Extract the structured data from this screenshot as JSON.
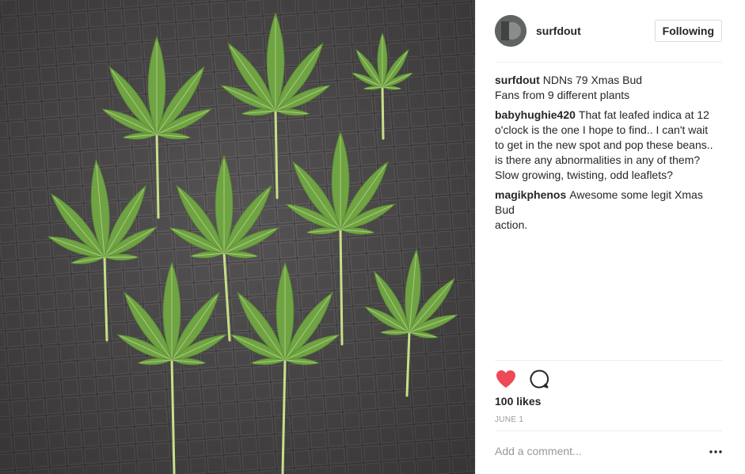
{
  "post": {
    "username": "surfdout",
    "follow_label": "Following",
    "photo_icon": "cannabis-fan-leaves-photo"
  },
  "comments": [
    {
      "user": "surfdout",
      "lines": [
        "NDNs 79 Xmas Bud",
        "Fans from 9 different plants"
      ]
    },
    {
      "user": "babyhughie420",
      "lines": [
        "That fat leafed indica at 12",
        "o'clock is the one I hope to find.. I can't wait",
        "to get in the new spot and pop these beans..",
        "is there any abnormalities in any of them?",
        "Slow growing, twisting, odd leaflets?"
      ]
    },
    {
      "user": "magikphenos",
      "lines": [
        "Awesome some legit Xmas Bud",
        "action."
      ]
    }
  ],
  "actions": {
    "like_icon": "heart-icon",
    "comment_icon": "comment-bubble-icon",
    "more_icon": "more-options-icon"
  },
  "likes": "100 likes",
  "date": "JUNE 1",
  "add_comment_placeholder": "Add a comment...",
  "colors": {
    "heart": "#ed4956",
    "leaf": "#6fa343",
    "stem": "#c6e08a",
    "background_tarp": "#4a4748",
    "border": "#efefef"
  }
}
